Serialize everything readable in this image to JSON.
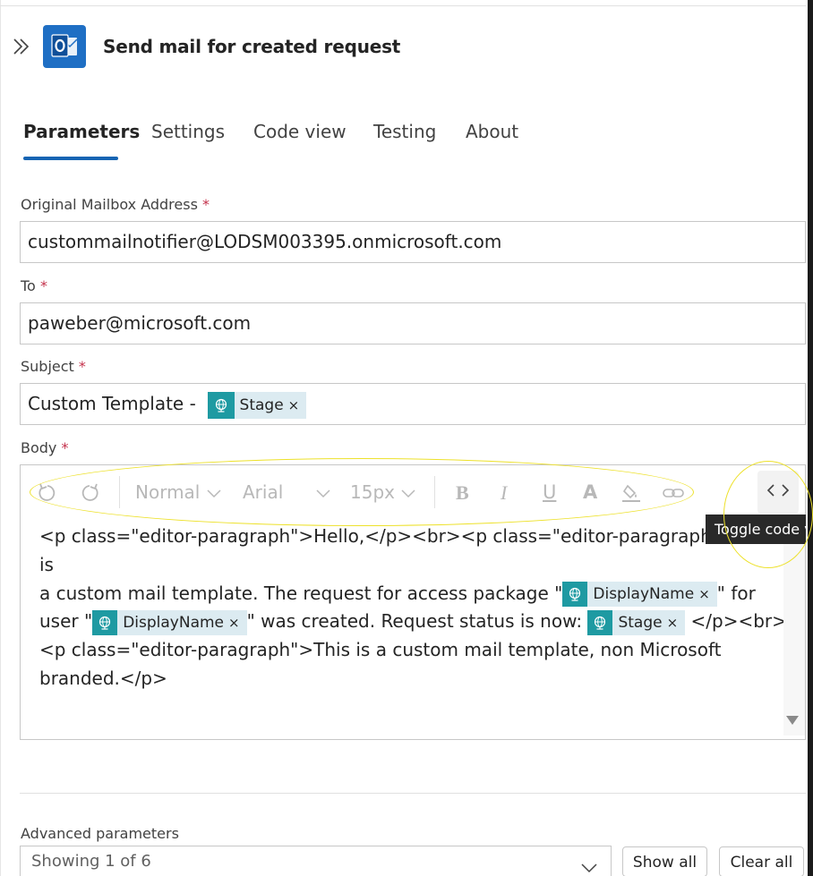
{
  "header": {
    "title": "Send mail for created request",
    "expand_icon": "double-chevron-right-icon",
    "app_icon": "outlook-icon",
    "app_color": "#1f6fc4"
  },
  "tabs": [
    {
      "label": "Parameters",
      "active": true
    },
    {
      "label": "Settings",
      "active": false
    },
    {
      "label": "Code view",
      "active": false
    },
    {
      "label": "Testing",
      "active": false
    },
    {
      "label": "About",
      "active": false
    }
  ],
  "accent_color": "#1664b3",
  "required_marker": "*",
  "fields": {
    "mailbox": {
      "label": "Original Mailbox Address",
      "value": "custommailnotifier@LODSM003395.onmicrosoft.com"
    },
    "to": {
      "label": "To",
      "value": "paweber@microsoft.com"
    },
    "subject": {
      "label": "Subject",
      "prefix": "Custom Template - ",
      "token": "Stage"
    },
    "body": {
      "label": "Body"
    }
  },
  "token_color": "#1e9aa2",
  "token_remove": "×",
  "toolbar": {
    "undo_icon": "undo-icon",
    "redo_icon": "redo-icon",
    "block_type": "Normal",
    "font": "Arial",
    "font_size": "15px",
    "bold": "B",
    "italic": "I",
    "underline": "U",
    "font_color": "A",
    "highlight_icon": "highlight-icon",
    "link_icon": "link-icon",
    "toggle_code_icon": "code-brackets-icon",
    "toggle_code_tooltip": "Toggle code v"
  },
  "body_code": {
    "part1": "<p class=\"editor-paragraph\">Hello,</p><br><p class=\"editor-paragraph\">This is",
    "part2": "a custom mail template. The request for access package \"",
    "token1": "DisplayName",
    "part3": "\" for",
    "part4": "user \"",
    "token2": "DisplayName",
    "part5": "\" was created. Request status is now: ",
    "token3": "Stage",
    "part6": " </p><br>",
    "part7": "<p class=\"editor-paragraph\">This is a custom mail template, non Microsoft",
    "part8": "branded.</p>"
  },
  "annotation_color": "#ede12a",
  "advanced": {
    "label": "Advanced parameters",
    "selected": "Showing 1 of 6",
    "show_all": "Show all",
    "clear_all": "Clear all"
  }
}
